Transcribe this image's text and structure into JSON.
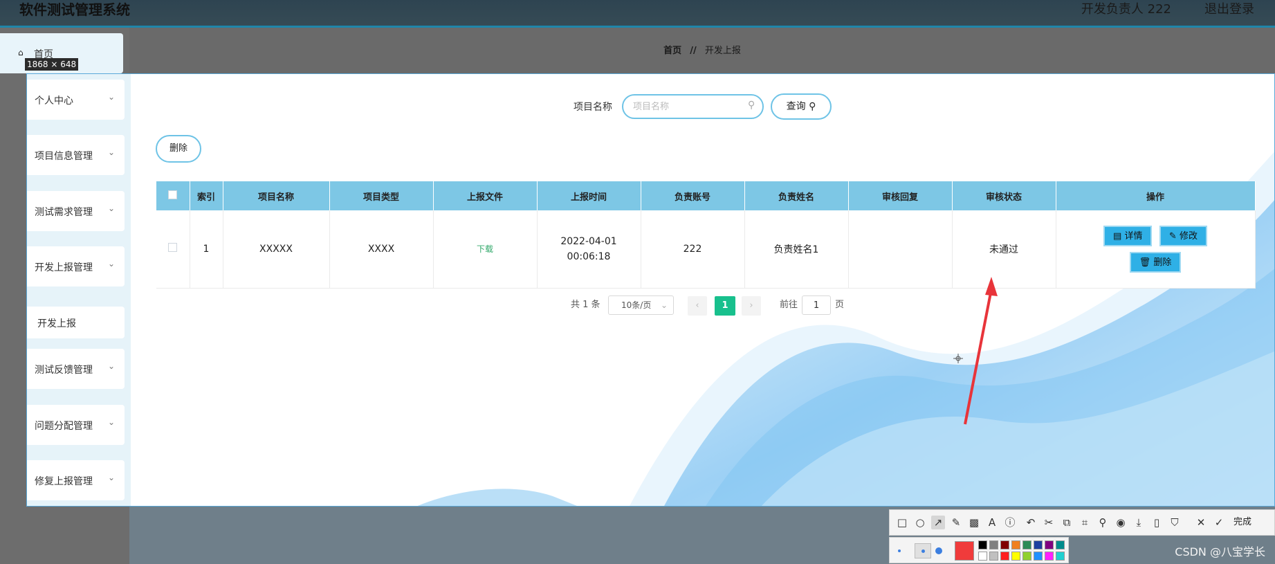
{
  "header": {
    "app_title": "软件测试管理系统",
    "user_label": "开发负责人 222",
    "logout_label": "退出登录"
  },
  "sidebar": {
    "home": "首页",
    "items": [
      {
        "label": "个人中心"
      },
      {
        "label": "项目信息管理"
      },
      {
        "label": "测试需求管理"
      },
      {
        "label": "开发上报管理"
      },
      {
        "label": "测试反馈管理"
      },
      {
        "label": "问题分配管理"
      },
      {
        "label": "修复上报管理"
      }
    ],
    "sub_item": "开发上报"
  },
  "capture_size_label": "1868 × 648",
  "breadcrumb": {
    "home": "首页",
    "separator": "//",
    "current": "开发上报"
  },
  "search": {
    "label": "项目名称",
    "placeholder": "项目名称",
    "query_button": "查询"
  },
  "delete_button": "删除",
  "table": {
    "columns": [
      "索引",
      "项目名称",
      "项目类型",
      "上报文件",
      "上报时间",
      "负责账号",
      "负责姓名",
      "审核回复",
      "审核状态",
      "操作"
    ],
    "rows": [
      {
        "index": "1",
        "project_name": "XXXXX",
        "project_type": "XXXX",
        "file": "下载",
        "time": "2022-04-01 00:06:18",
        "account": "222",
        "owner_name": "负责姓名1",
        "reply": "",
        "status": "未通过",
        "actions": {
          "detail": "详情",
          "edit": "修改",
          "delete": "删除"
        }
      }
    ]
  },
  "pagination": {
    "total": "共 1 条",
    "page_size": "10条/页",
    "current_page": "1",
    "goto_prefix": "前往",
    "goto_value": "1",
    "goto_suffix": "页"
  },
  "toolbar": {
    "done_label": "完成",
    "icons": [
      "rectangle-icon",
      "circle-icon",
      "arrow-icon",
      "pen-icon",
      "mosaic-icon",
      "text-icon",
      "number-icon",
      "undo-icon",
      "cut-icon",
      "translate-icon",
      "scan-icon",
      "pin-icon",
      "record-icon",
      "download-icon",
      "phone-icon",
      "bookmark-icon",
      "close-icon",
      "confirm-icon"
    ],
    "colors_top": [
      "#000000",
      "#808080",
      "#800000",
      "#f08020",
      "#2e8b57",
      "#1e3fa0",
      "#800080",
      "#008b8b"
    ],
    "colors_bottom": [
      "#ffffff",
      "#c0c0c0",
      "#ff2020",
      "#ffff00",
      "#90d030",
      "#2090ff",
      "#ff20ff",
      "#20d0d0"
    ],
    "current_color": "#f03b3b"
  },
  "watermark": "CSDN @八宝学长",
  "colors": {
    "accent": "#7dc7e5",
    "button": "#2fb0e6",
    "page_active": "#18c08d",
    "annotation": "#e8343a"
  }
}
